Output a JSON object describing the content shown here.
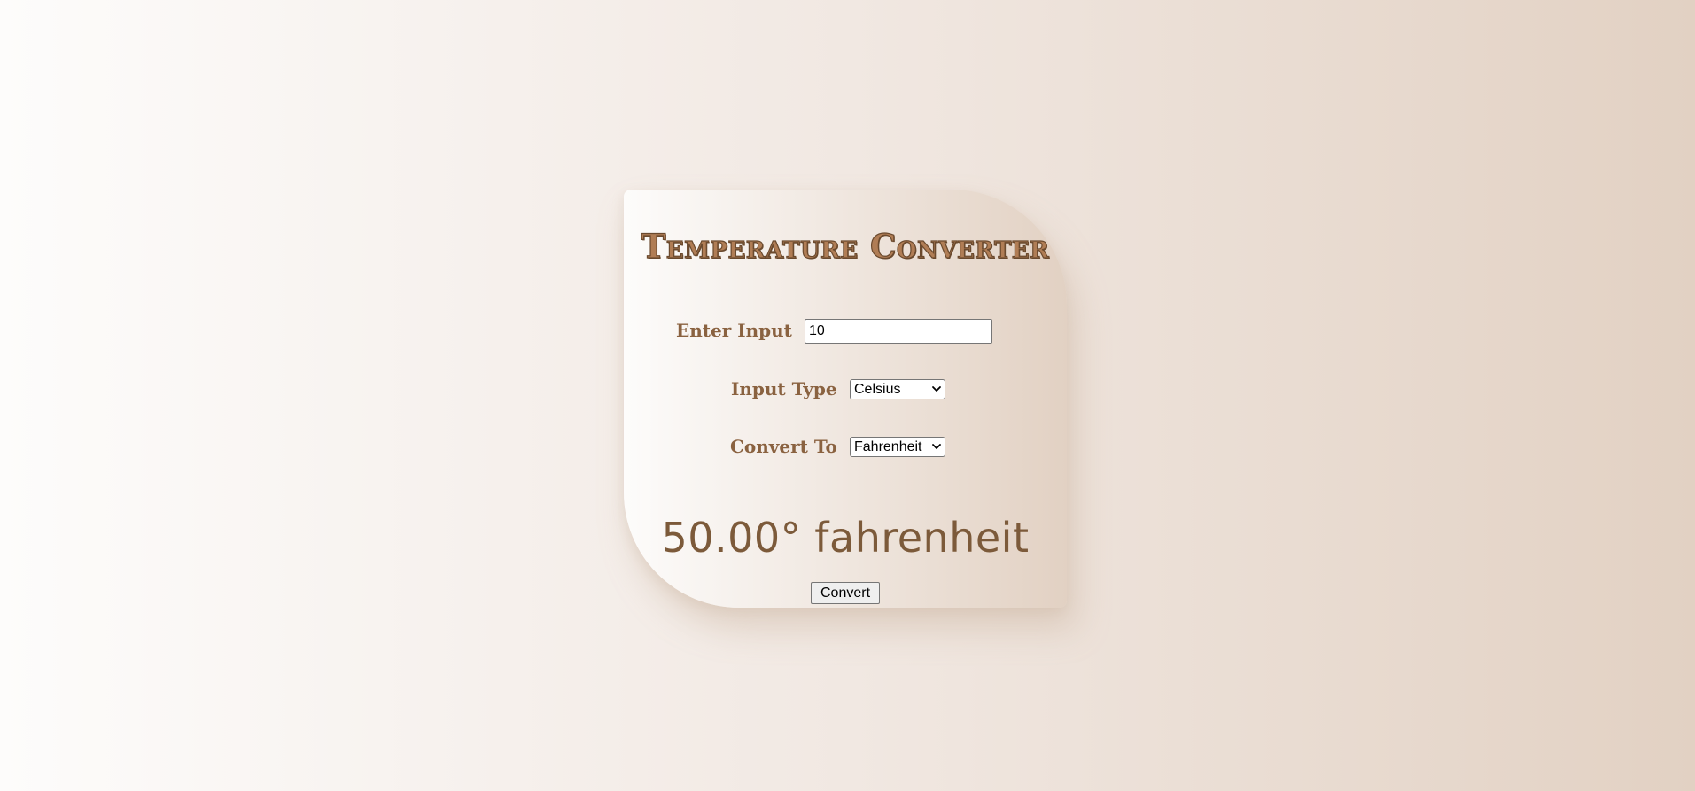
{
  "app": {
    "title": "Temperature Converter"
  },
  "form": {
    "input_label": "Enter Input",
    "input_value": "10",
    "input_type_label": "Input Type",
    "input_type_selected": "Celsius",
    "convert_to_label": "Convert To",
    "convert_to_selected": "Fahrenheit"
  },
  "result": {
    "text": "50.00° fahrenheit"
  },
  "actions": {
    "convert_label": "Convert"
  },
  "colors": {
    "accent": "#8a6240",
    "background_start": "#fdfcfb",
    "background_end": "#e2d1c3"
  },
  "icons": {
    "dropdown": "chevron-down-icon"
  }
}
